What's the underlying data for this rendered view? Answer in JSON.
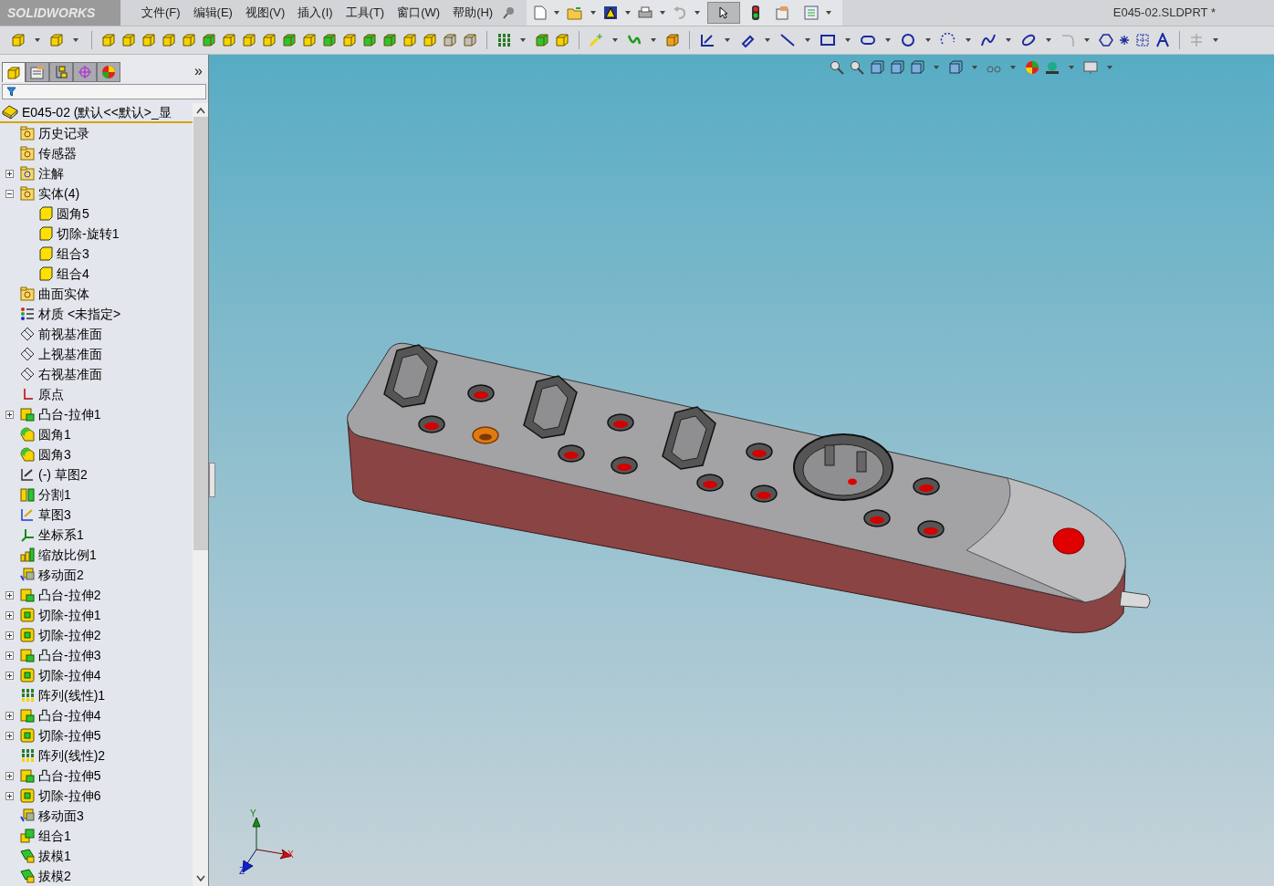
{
  "app": {
    "logo": "SOLIDWORKS",
    "menu": [
      "文件(F)",
      "编辑(E)",
      "视图(V)",
      "插入(I)",
      "工具(T)",
      "窗口(W)",
      "帮助(H)"
    ],
    "document_title": "E045-02.SLDPRT *"
  },
  "panel_tabs": [
    {
      "kind": "tree",
      "selected": true
    },
    {
      "kind": "property",
      "selected": false
    },
    {
      "kind": "config",
      "selected": false
    },
    {
      "kind": "dim",
      "selected": false
    },
    {
      "kind": "display",
      "selected": false
    }
  ],
  "panel_more": "»",
  "tree": {
    "root": "E045-02  (默认<<默认>_显",
    "items": [
      {
        "label": "历史记录",
        "kind": "history"
      },
      {
        "label": "传感器",
        "kind": "sensor"
      },
      {
        "label": "注解",
        "kind": "annot",
        "expanded": false
      },
      {
        "label": "实体(4)",
        "kind": "bodies",
        "expanded": true,
        "children": [
          {
            "label": "圆角5",
            "kind": "body"
          },
          {
            "label": "切除-旋转1",
            "kind": "body"
          },
          {
            "label": "组合3",
            "kind": "body"
          },
          {
            "label": "组合4",
            "kind": "body"
          }
        ]
      },
      {
        "label": "曲面实体",
        "kind": "surface"
      },
      {
        "label": "材质 <未指定>",
        "kind": "material"
      },
      {
        "label": "前视基准面",
        "kind": "plane"
      },
      {
        "label": "上视基准面",
        "kind": "plane"
      },
      {
        "label": "右视基准面",
        "kind": "plane"
      },
      {
        "label": "原点",
        "kind": "origin"
      },
      {
        "label": "凸台-拉伸1",
        "kind": "boss",
        "expanded": false
      },
      {
        "label": "圆角1",
        "kind": "fillet"
      },
      {
        "label": "圆角3",
        "kind": "fillet"
      },
      {
        "label": "(-) 草图2",
        "kind": "sketch"
      },
      {
        "label": "分割1",
        "kind": "split"
      },
      {
        "label": "草图3",
        "kind": "sketch2"
      },
      {
        "label": "坐标系1",
        "kind": "coords"
      },
      {
        "label": "缩放比例1",
        "kind": "scale"
      },
      {
        "label": "移动面2",
        "kind": "move"
      },
      {
        "label": "凸台-拉伸2",
        "kind": "boss",
        "expanded": false
      },
      {
        "label": "切除-拉伸1",
        "kind": "cut",
        "expanded": false
      },
      {
        "label": "切除-拉伸2",
        "kind": "cut",
        "expanded": false
      },
      {
        "label": "凸台-拉伸3",
        "kind": "boss",
        "expanded": false
      },
      {
        "label": "切除-拉伸4",
        "kind": "cut",
        "expanded": false
      },
      {
        "label": "阵列(线性)1",
        "kind": "pattern"
      },
      {
        "label": "凸台-拉伸4",
        "kind": "boss",
        "expanded": false
      },
      {
        "label": "切除-拉伸5",
        "kind": "cut",
        "expanded": false
      },
      {
        "label": "阵列(线性)2",
        "kind": "pattern"
      },
      {
        "label": "凸台-拉伸5",
        "kind": "boss",
        "expanded": false
      },
      {
        "label": "切除-拉伸6",
        "kind": "cut",
        "expanded": false
      },
      {
        "label": "移动面3",
        "kind": "move"
      },
      {
        "label": "组合1",
        "kind": "combine"
      },
      {
        "label": "拔模1",
        "kind": "draft"
      },
      {
        "label": "拔模2",
        "kind": "draft"
      }
    ]
  },
  "triad": {
    "x": "X",
    "y": "Y",
    "z": "Z"
  }
}
